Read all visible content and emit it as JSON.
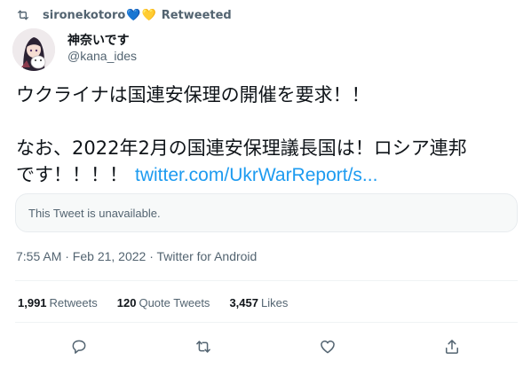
{
  "retweet_header": {
    "user": "sironekotoro",
    "hearts": [
      "💙",
      "💛"
    ],
    "label": "Retweeted",
    "icon": "retweet-icon"
  },
  "author": {
    "display_name": "神奈いです",
    "handle": "@kana_ides",
    "avatar": "anime-character-avatar"
  },
  "tweet": {
    "line1": "ウクライナは国連安保理の開催を要求！！",
    "line2": "なお、2022年2月の国連安保理議長国は！ロシア連邦",
    "line3": "です！！！！",
    "link": "twitter.com/UkrWarReport/s..."
  },
  "quote": {
    "text": "This Tweet is unavailable."
  },
  "meta": {
    "time": "7:55 AM · Feb 21, 2022 · Twitter for Android"
  },
  "stats": {
    "retweets_count": "1,991",
    "retweets_label": "Retweets",
    "quotes_count": "120",
    "quotes_label": "Quote Tweets",
    "likes_count": "3,457",
    "likes_label": "Likes"
  },
  "actions": {
    "reply": "reply-icon",
    "retweet": "retweet-icon",
    "like": "heart-icon",
    "share": "share-icon"
  },
  "colors": {
    "link": "#1d9bf0",
    "muted": "#536471",
    "text": "#0f1419"
  }
}
